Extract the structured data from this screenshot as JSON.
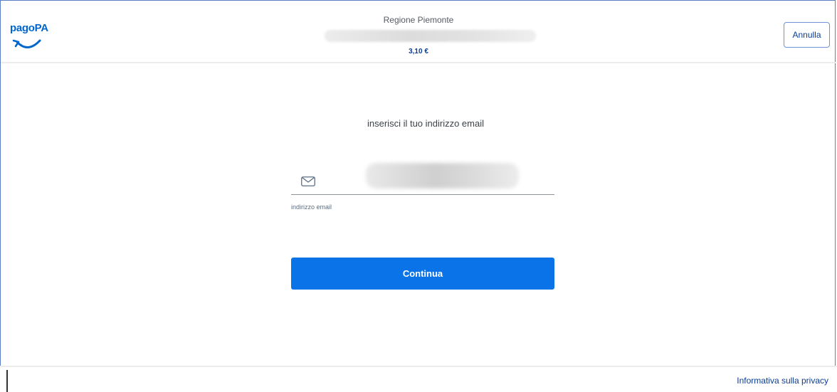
{
  "header": {
    "logo_text": "pagoPA",
    "payee": "Regione Piemonte",
    "amount": "3,10 €",
    "cancel_label": "Annulla"
  },
  "main": {
    "prompt": "inserisci il tuo indirizzo email",
    "email_field": {
      "label": "indirizzo email",
      "icon": "mail-icon",
      "value": ""
    },
    "continue_label": "Continua"
  },
  "footer": {
    "privacy_label": "Informativa sulla privacy"
  },
  "colors": {
    "primary": "#0a73e8",
    "brand": "#0066cc",
    "text_dark": "#0b3d91"
  }
}
